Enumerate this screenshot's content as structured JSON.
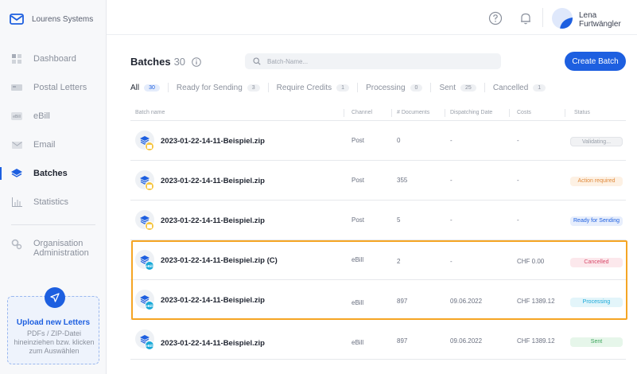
{
  "app": {
    "brand": "Lourens Systems"
  },
  "colors": {
    "accent": "#1d5fe0",
    "highlight": "#f5a524",
    "post_badge": "#f5c542",
    "ebill_badge": "#18a8d8"
  },
  "sidebar": {
    "items": [
      {
        "label": "Dashboard",
        "icon": "dashboard-icon"
      },
      {
        "label": "Postal Letters",
        "icon": "letters-icon"
      },
      {
        "label": "eBill",
        "icon": "ebill-icon"
      },
      {
        "label": "Email",
        "icon": "email-icon"
      },
      {
        "label": "Batches",
        "icon": "batches-icon",
        "active": true
      },
      {
        "label": "Statistics",
        "icon": "statistics-icon"
      }
    ],
    "org_line1": "Organisation",
    "org_line2": "Administration",
    "upload_title": "Upload new Letters",
    "upload_line1": "PDFs / ZIP-Datei",
    "upload_line2": "hineinziehen bzw. klicken",
    "upload_line3": "zum Auswählen"
  },
  "header": {
    "user_first": "Lena",
    "user_last": "Furtwängler"
  },
  "main": {
    "title": "Batches",
    "count": "30",
    "search_placeholder": "Batch-Name...",
    "create_label": "Create Batch",
    "tabs": [
      {
        "label": "All",
        "count": "30",
        "active": true
      },
      {
        "label": "Ready for Sending",
        "count": "3"
      },
      {
        "label": "Require Credits",
        "count": "1"
      },
      {
        "label": "Processing",
        "count": "0"
      },
      {
        "label": "Sent",
        "count": "25"
      },
      {
        "label": "Cancelled",
        "count": "1"
      }
    ],
    "columns": [
      "Batch name",
      "Channel",
      "# Documents",
      "Dispatching Date",
      "Costs",
      "Status"
    ],
    "rows": [
      {
        "name": "2023-01-22-14-11-Beispiel.zip",
        "channel": "Post",
        "docs": "0",
        "date": "-",
        "cost": "-",
        "status": "Validating...",
        "status_type": "validating"
      },
      {
        "name": "2023-01-22-14-11-Beispiel.zip",
        "channel": "Post",
        "docs": "355",
        "date": "-",
        "cost": "-",
        "status": "Action required",
        "status_type": "action"
      },
      {
        "name": "2023-01-22-14-11-Beispiel.zip",
        "channel": "Post",
        "docs": "5",
        "date": "-",
        "cost": "-",
        "status": "Ready for Sending",
        "status_type": "ready"
      },
      {
        "name": "2023-01-22-14-11-Beispiel.zip (C)",
        "channel": "eBill",
        "docs": "2",
        "date": "-",
        "cost": "CHF 0.00",
        "status": "Cancelled",
        "status_type": "cancelled"
      },
      {
        "name": "2023-01-22-14-11-Beispiel.zip",
        "channel": "eBill",
        "docs": "897",
        "date": "09.06.2022",
        "cost": "CHF 1389.12",
        "status": "Processing",
        "status_type": "processing"
      },
      {
        "name": "2023-01-22-14-11-Beispiel.zip",
        "channel": "eBill",
        "docs": "897",
        "date": "09.06.2022",
        "cost": "CHF 1389.12",
        "status": "Sent",
        "status_type": "sent"
      }
    ]
  }
}
